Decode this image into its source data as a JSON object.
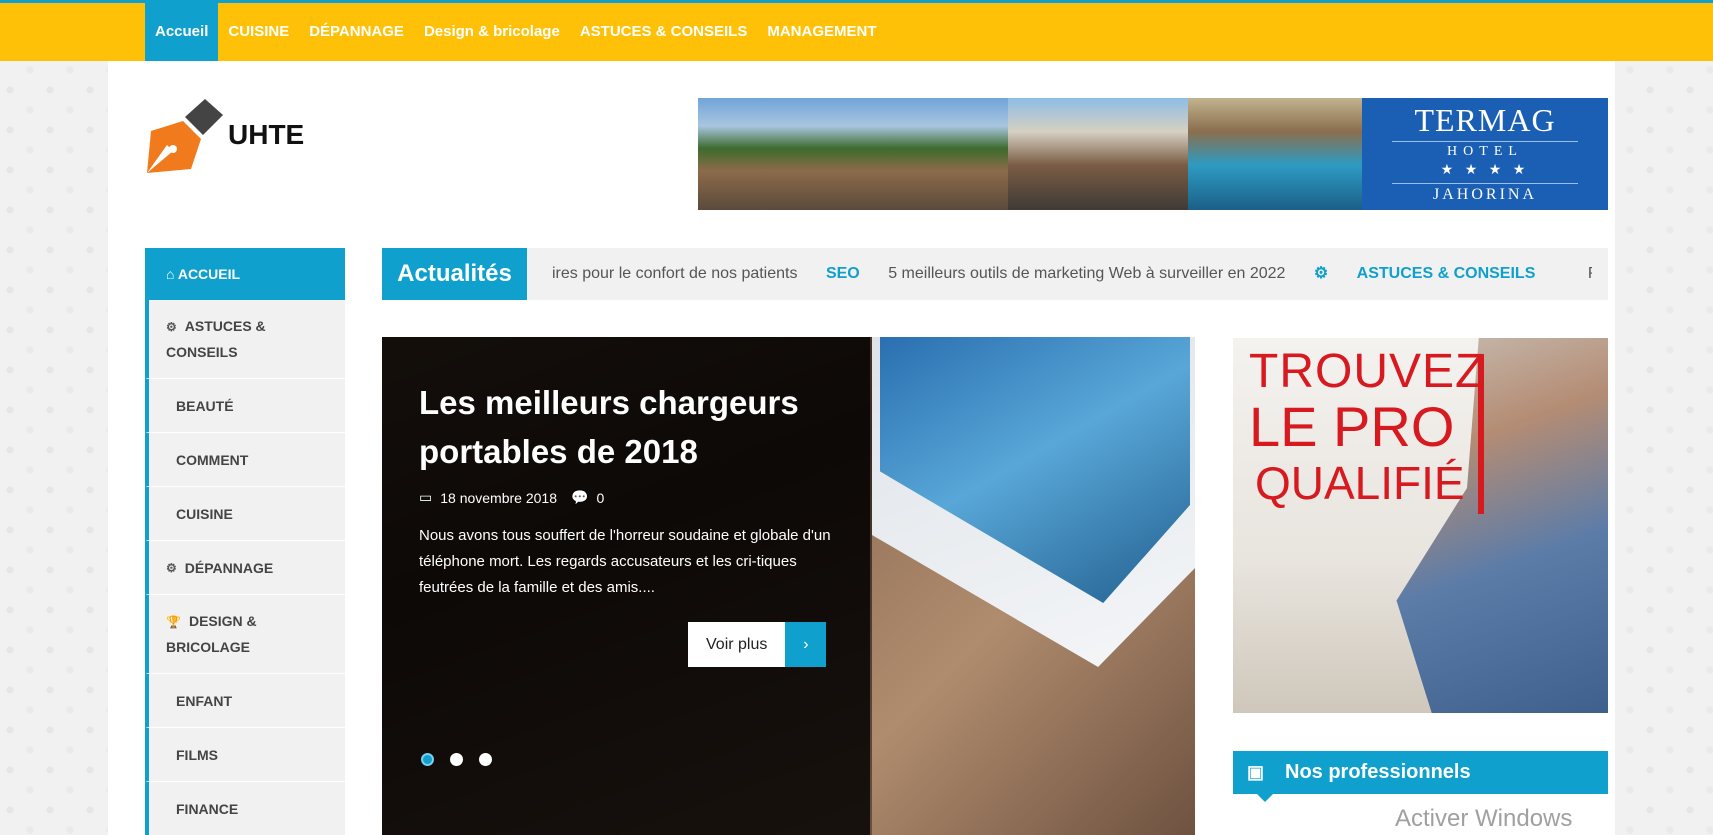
{
  "nav": {
    "items": [
      {
        "label": "Accueil",
        "active": true
      },
      {
        "label": "CUISINE"
      },
      {
        "label": "DÉPANNAGE"
      },
      {
        "label": "Design & bricolage"
      },
      {
        "label": "ASTUCES & CONSEILS"
      },
      {
        "label": "MANAGEMENT"
      }
    ]
  },
  "logo": {
    "text": "UHTE"
  },
  "banner": {
    "brand_name": "TERMAG",
    "brand_type": "HOTEL",
    "brand_stars": "★ ★ ★ ★",
    "brand_location": "JAHORINA"
  },
  "sidebar": {
    "home": "ACCUEIL",
    "items": [
      {
        "label": "ASTUCES & CONSEILS",
        "icon": "gear-icon"
      },
      {
        "label": "BEAUTÉ"
      },
      {
        "label": "COMMENT"
      },
      {
        "label": "CUISINE"
      },
      {
        "label": "DÉPANNAGE",
        "icon": "gear-icon"
      },
      {
        "label": "DESIGN & BRICOLAGE",
        "icon": "trophy-icon"
      },
      {
        "label": "ENFANT"
      },
      {
        "label": "FILMS"
      },
      {
        "label": "FINANCE"
      }
    ]
  },
  "ticker": {
    "label": "Actualités",
    "item1": "ires pour le confort de nos patients",
    "cat1": "SEO",
    "item2": "5 meilleurs outils de marketing Web à surveiller en 2022",
    "cat2": "ASTUCES & CONSEILS",
    "item3": "Pa"
  },
  "slide": {
    "title": "Les meilleurs chargeurs portables de 2018",
    "date": "18 novembre 2018",
    "comments": "0",
    "excerpt": "Nous avons tous souffert de l'horreur soudaine et globale d'un téléphone mort. Les regards accusateurs et les cri-tiques feutrées de la famille et des amis....",
    "more_label": "Voir plus",
    "more_arrow": "›"
  },
  "ad": {
    "line1": "TROUVEZ",
    "line2": "LE PRO",
    "line3": "QUALIFIÉ"
  },
  "widget": {
    "title": "Nos professionnels"
  },
  "watermark": "Activer Windows",
  "colors": {
    "accent": "#0fa0ce",
    "topbar": "#ffc107",
    "ad_red": "#d71920"
  }
}
